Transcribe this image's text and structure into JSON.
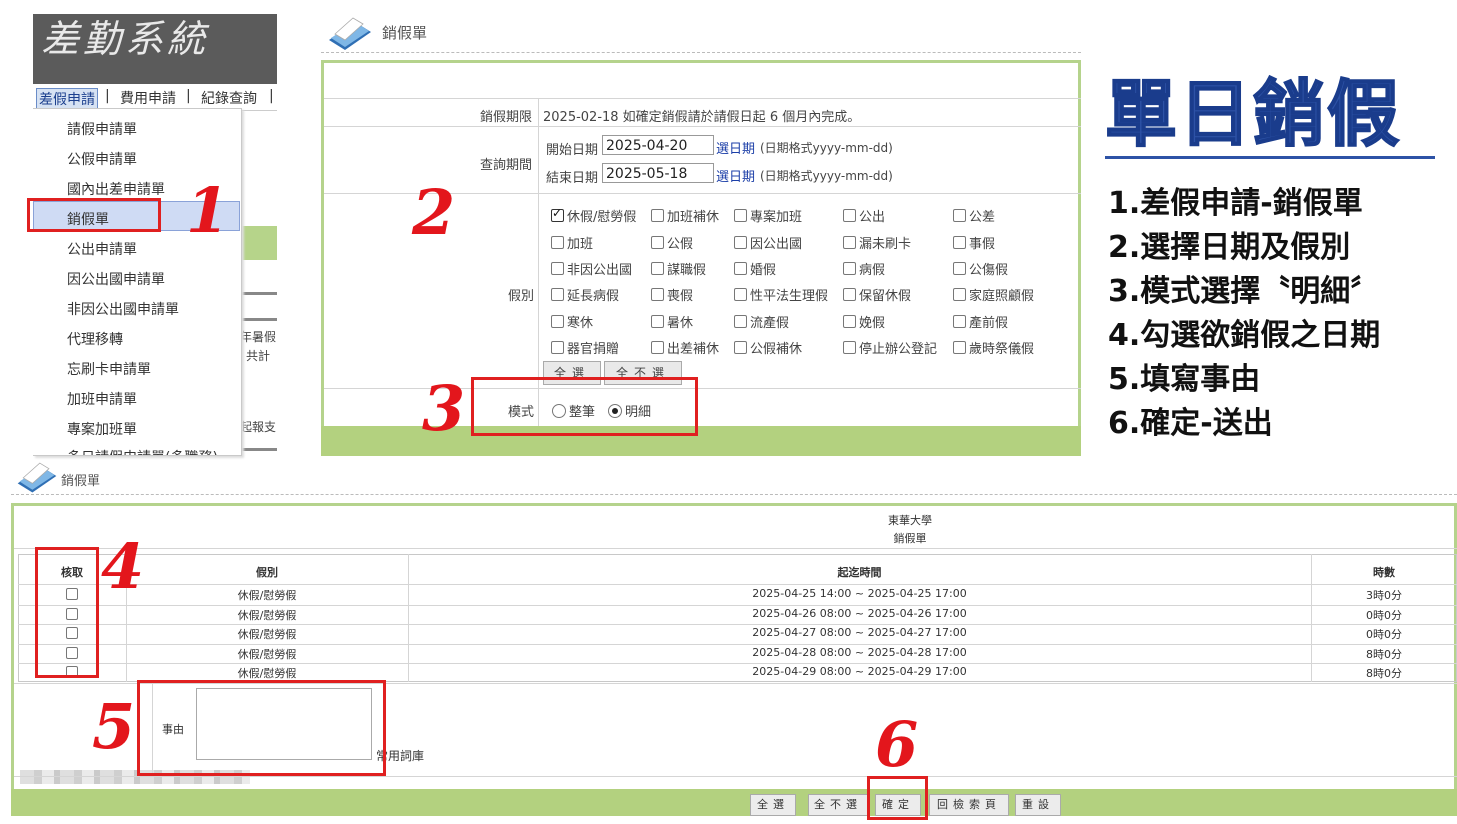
{
  "panel1": {
    "brand": "差勤系統",
    "topnav": [
      "差假申請",
      "費用申請",
      "紀錄查詢"
    ],
    "menu": [
      "請假申請單",
      "公假申請單",
      "國內出差申請單",
      "銷假單",
      "公出申請單",
      "因公出國申請單",
      "非因公出國申請單",
      "代理移轉",
      "忘刷卡申請單",
      "加班申請單",
      "專案加班單",
      "多日請假申請單(多職務)"
    ],
    "side_texts": [
      "年暑假",
      "共計",
      "起報支"
    ]
  },
  "form": {
    "title": "銷假單",
    "row_deadline_label": "銷假期限",
    "row_deadline_text": "2025-02-18  如確定銷假請於請假日起  6  個月內完成。",
    "row_period_label": "查詢期間",
    "start_label": "開始日期",
    "start_value": "2025-04-20",
    "end_label": "結束日期",
    "end_value": "2025-05-18",
    "pick_label": "選日期",
    "date_format": "(日期格式yyyy-mm-dd)",
    "type_label": "假別",
    "leave_types": [
      [
        "休假/慰勞假",
        "加班補休",
        "專案加班",
        "公出",
        "公差"
      ],
      [
        "加班",
        "公假",
        "因公出國",
        "漏未刷卡",
        "事假"
      ],
      [
        "非因公出國",
        "謀職假",
        "婚假",
        "病假",
        "公傷假"
      ],
      [
        "延長病假",
        "喪假",
        "性平法生理假",
        "保留休假",
        "家庭照顧假"
      ],
      [
        "寒休",
        "暑休",
        "流產假",
        "娩假",
        "產前假"
      ],
      [
        "器官捐贈",
        "出差補休",
        "公假補休",
        "停止辦公登記",
        "歲時祭儀假"
      ]
    ],
    "select_all": "全選",
    "select_none": "全不選",
    "mode_label": "模式",
    "mode_options": [
      "整筆",
      "明細"
    ],
    "mode_selected": "明細"
  },
  "annotations": [
    "1",
    "2",
    "3",
    "4",
    "5",
    "6"
  ],
  "instructions": {
    "title": "單日銷假",
    "steps": [
      "1.差假申請-銷假單",
      "2.選擇日期及假別",
      "3.模式選擇〝明細〞",
      "4.勾選欲銷假之日期",
      "5.填寫事由",
      "6.確定-送出"
    ]
  },
  "result": {
    "title": "銷假單",
    "org": "東華大學",
    "form_name": "銷假單",
    "headers": [
      "核取",
      "假別",
      "起迄時間",
      "時數"
    ],
    "rows": [
      {
        "type": "休假/慰勞假",
        "range": "2025-04-25 14:00 ~ 2025-04-25 17:00",
        "hours": "3時0分"
      },
      {
        "type": "休假/慰勞假",
        "range": "2025-04-26 08:00 ~ 2025-04-26 17:00",
        "hours": "0時0分"
      },
      {
        "type": "休假/慰勞假",
        "range": "2025-04-27 08:00 ~ 2025-04-27 17:00",
        "hours": "0時0分"
      },
      {
        "type": "休假/慰勞假",
        "range": "2025-04-28 08:00 ~ 2025-04-28 17:00",
        "hours": "8時0分"
      },
      {
        "type": "休假/慰勞假",
        "range": "2025-04-29 08:00 ~ 2025-04-29 17:00",
        "hours": "8時0分"
      }
    ],
    "reason_label": "事由",
    "phrase_link": "常用詞庫",
    "buttons": [
      "全選",
      "全不選",
      "確定",
      "回檢索頁",
      "重設"
    ]
  }
}
